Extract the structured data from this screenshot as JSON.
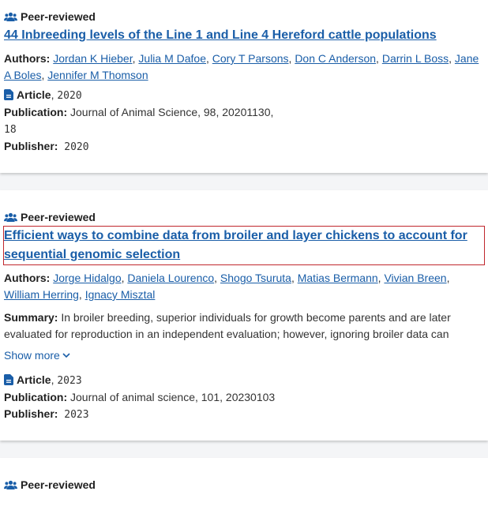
{
  "results": [
    {
      "peer_label": "Peer-reviewed",
      "title": "44 Inbreeding levels of the Line 1 and Line 4 Hereford cattle populations",
      "authors_label": "Authors:",
      "authors": [
        "Jordan K Hieber",
        "Julia M Dafoe",
        "Cory T Parsons",
        "Don C Anderson",
        "Darrin L Boss",
        "Jane A Boles",
        "Jennifer M Thomson"
      ],
      "type_label": "Article",
      "type_year": "2020",
      "publication_label": "Publication:",
      "publication_text": "Journal of Animal Science, 98, 20201130,",
      "publication_text2": "18",
      "publisher_label": "Publisher:",
      "publisher_value": "2020"
    },
    {
      "peer_label": "Peer-reviewed",
      "title": "Efficient ways to combine data from broiler and layer chickens to account for sequential genomic selection",
      "authors_label": "Authors:",
      "authors": [
        "Jorge Hidalgo",
        "Daniela Lourenco",
        "Shogo Tsuruta",
        "Matias Bermann",
        "Vivian Breen",
        "William Herring",
        "Ignacy Misztal"
      ],
      "summary_label": "Summary:",
      "summary_text": "In broiler breeding, superior individuals for growth become parents and are later evaluated for reproduction in an independent evaluation; however, ignoring broiler data can",
      "show_more": "Show more",
      "type_label": "Article",
      "type_year": "2023",
      "publication_label": "Publication:",
      "publication_text": "Journal of animal science, 101, 20230103",
      "publisher_label": "Publisher:",
      "publisher_value": "2023"
    },
    {
      "peer_label": "Peer-reviewed"
    }
  ]
}
